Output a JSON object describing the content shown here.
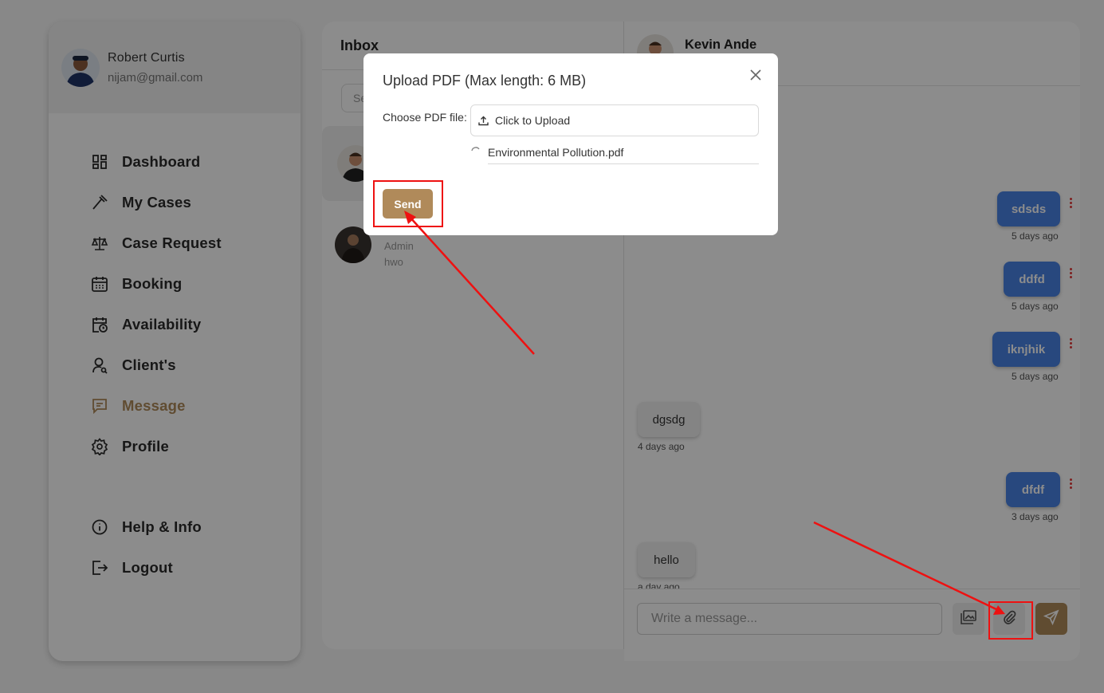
{
  "user": {
    "name": "Robert Curtis",
    "email": "nijam@gmail.com"
  },
  "nav": {
    "items": [
      {
        "label": "Dashboard",
        "icon": "dashboard-grid-icon"
      },
      {
        "label": "My Cases",
        "icon": "gavel-icon"
      },
      {
        "label": "Case Request",
        "icon": "scale-icon"
      },
      {
        "label": "Booking",
        "icon": "calendar-icon"
      },
      {
        "label": "Availability",
        "icon": "calendar-clock-icon"
      },
      {
        "label": "Client's",
        "icon": "user-icon"
      },
      {
        "label": "Message",
        "icon": "message-icon",
        "active": true
      },
      {
        "label": "Profile",
        "icon": "gear-icon"
      }
    ],
    "bottom": [
      {
        "label": "Help & Info",
        "icon": "info-icon"
      },
      {
        "label": "Logout",
        "icon": "logout-icon"
      }
    ]
  },
  "inbox": {
    "title": "Inbox",
    "search_placeholder": "Se",
    "conversations": [
      {
        "active": true
      },
      {
        "role": "Admin",
        "preview": "hwo"
      }
    ]
  },
  "chat": {
    "contact_name": "Kevin Ande",
    "messages": [
      {
        "text": "sdsds",
        "time": "5 days ago",
        "outgoing": true
      },
      {
        "text": "ddfd",
        "time": "5 days ago",
        "outgoing": true
      },
      {
        "text": "iknjhik",
        "time": "5 days ago",
        "outgoing": true
      },
      {
        "text": "dgsdg",
        "time": "4 days ago",
        "outgoing": false
      },
      {
        "text": "dfdf",
        "time": "3 days ago",
        "outgoing": true
      },
      {
        "text": "hello",
        "time": "a day ago",
        "outgoing": false
      }
    ],
    "input_placeholder": "Write a message..."
  },
  "modal": {
    "title": "Upload PDF (Max length: 6 MB)",
    "field_label": "Choose PDF file",
    "upload_label": "Click to Upload",
    "file_name": "Environmental Pollution.pdf",
    "send_label": "Send"
  },
  "colors": {
    "accent": "#b08a5a",
    "outgoing_bubble": "#4a84e6",
    "highlight": "#ee1111"
  }
}
